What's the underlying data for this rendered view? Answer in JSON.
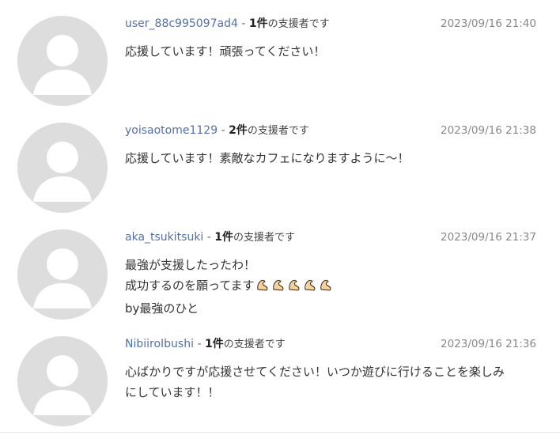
{
  "comments": [
    {
      "username": "user_88c995097ad4",
      "separator": "-",
      "count": "1件",
      "supporter_label": "の支援者です",
      "date": "2023/09/16 21:40",
      "lines": [
        "応援しています！頑張ってください！"
      ]
    },
    {
      "username": "yoisaotome1129",
      "separator": "-",
      "count": "2件",
      "supporter_label": "の支援者です",
      "date": "2023/09/16 21:38",
      "lines": [
        "応援しています！素敵なカフェになりますように〜！"
      ]
    },
    {
      "username": "aka_tsukitsuki",
      "separator": "-",
      "count": "1件",
      "supporter_label": "の支援者です",
      "date": "2023/09/16 21:37",
      "lines": [
        "最強が支援したったわ！",
        "成功するのを願ってます",
        "by最強のひと"
      ]
    },
    {
      "username": "NibiiroIbushi",
      "separator": "-",
      "count": "1件",
      "supporter_label": "の支援者です",
      "date": "2023/09/16 21:36",
      "lines": [
        "心ばかりですが応援させてください！いつか遊びに行けることを楽しみ",
        "にしています！！"
      ]
    }
  ],
  "icons": {
    "avatar": "default-user-avatar-icon",
    "emoji": "flexed-biceps-icon"
  },
  "colors": {
    "username": "#5470a8",
    "date": "#888888",
    "text": "#333333",
    "avatar_bg": "#dddddd"
  }
}
